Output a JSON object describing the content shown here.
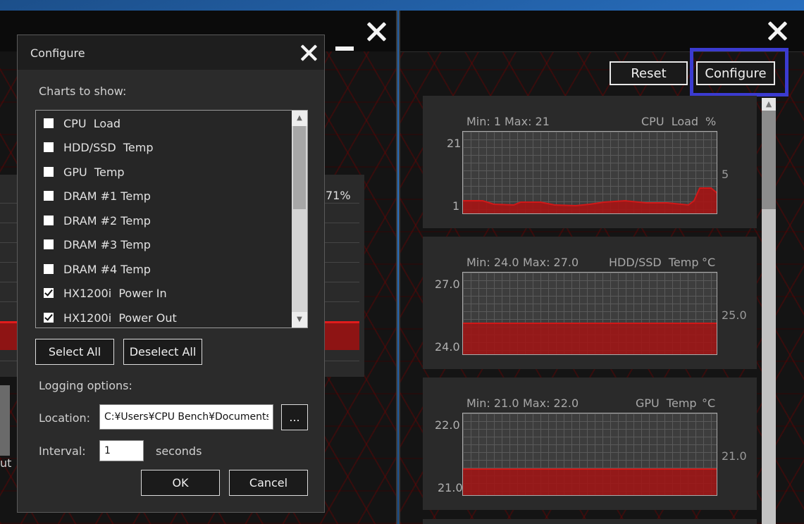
{
  "left_window": {
    "percent_readout": "71%",
    "partial_label": "ut"
  },
  "right_window": {
    "reset_label": "Reset",
    "configure_label": "Configure",
    "charts": [
      {
        "min": "Min: 1",
        "max": "Max: 21",
        "name": "CPU  Load",
        "unit": "%",
        "ymax": "21",
        "ymin": "1",
        "current": "5"
      },
      {
        "min": "Min: 24.0",
        "max": "Max: 27.0",
        "name": "HDD/SSD  Temp",
        "unit": "°C",
        "ymax": "27.0",
        "ymin": "24.0",
        "current": "25.0"
      },
      {
        "min": "Min: 21.0",
        "max": "Max: 22.0",
        "name": "GPU  Temp",
        "unit": "°C",
        "ymax": "22.0",
        "ymin": "21.0",
        "current": "21.0"
      }
    ]
  },
  "dialog": {
    "title": "Configure",
    "charts_to_show_label": "Charts to show:",
    "items": [
      {
        "label": "CPU  Load",
        "checked": false
      },
      {
        "label": "HDD/SSD  Temp",
        "checked": false
      },
      {
        "label": "GPU  Temp",
        "checked": false
      },
      {
        "label": "DRAM #1 Temp",
        "checked": false
      },
      {
        "label": "DRAM #2 Temp",
        "checked": false
      },
      {
        "label": "DRAM #3 Temp",
        "checked": false
      },
      {
        "label": "DRAM #4 Temp",
        "checked": false
      },
      {
        "label": "HX1200i  Power In",
        "checked": true
      },
      {
        "label": "HX1200i  Power Out",
        "checked": true
      }
    ],
    "select_all_label": "Select All",
    "deselect_all_label": "Deselect All",
    "logging_label": "Logging options:",
    "location_label": "Location:",
    "location_value": "C:¥Users¥CPU Bench¥Documents",
    "browse_label": "...",
    "interval_label": "Interval:",
    "interval_value": "1",
    "seconds_label": "seconds",
    "ok_label": "OK",
    "cancel_label": "Cancel"
  },
  "colors": {
    "accent_red": "#d01818",
    "highlight_blue": "#3b3bd0"
  }
}
